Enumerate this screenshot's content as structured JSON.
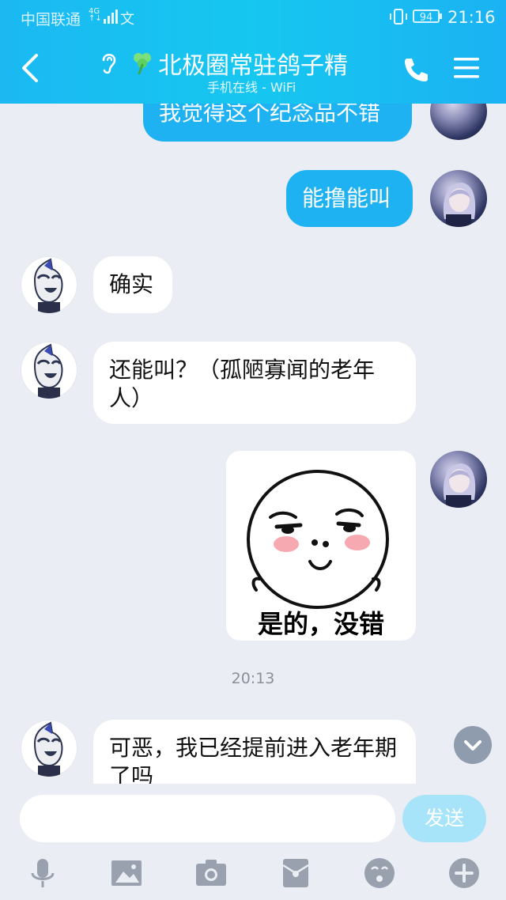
{
  "status_bar": {
    "carrier": "中国联通",
    "network_badge_top": "4G",
    "network_badge_bottom": "↑↓",
    "misc": "文",
    "battery": "94",
    "time": "21:16"
  },
  "header": {
    "title": "北极圈常驻鸽子精",
    "subtitle": "手机在线 - WiFi"
  },
  "messages": [
    {
      "side": "out",
      "text": "我觉得这个纪念品不错"
    },
    {
      "side": "out",
      "text": "能撸能叫"
    },
    {
      "side": "in",
      "text": "确实"
    },
    {
      "side": "in",
      "text": "还能叫？（孤陋寡闻的老年人）"
    },
    {
      "side": "out",
      "type": "sticker",
      "caption": "是的，没错"
    },
    {
      "side": "in",
      "text": "可恶，我已经提前进入老年期了吗"
    }
  ],
  "timestamp": "20:13",
  "input": {
    "value": "",
    "send_label": "发送"
  },
  "toolbar": [
    "mic-icon",
    "image-icon",
    "camera-icon",
    "red-packet-icon",
    "emoji-icon",
    "plus-icon"
  ],
  "colors": {
    "header": "#16c7f0",
    "bubble_out": "#1fb2f2",
    "bubble_in": "#ffffff",
    "background": "#eaedf3",
    "send_disabled": "#a8e4f9"
  }
}
